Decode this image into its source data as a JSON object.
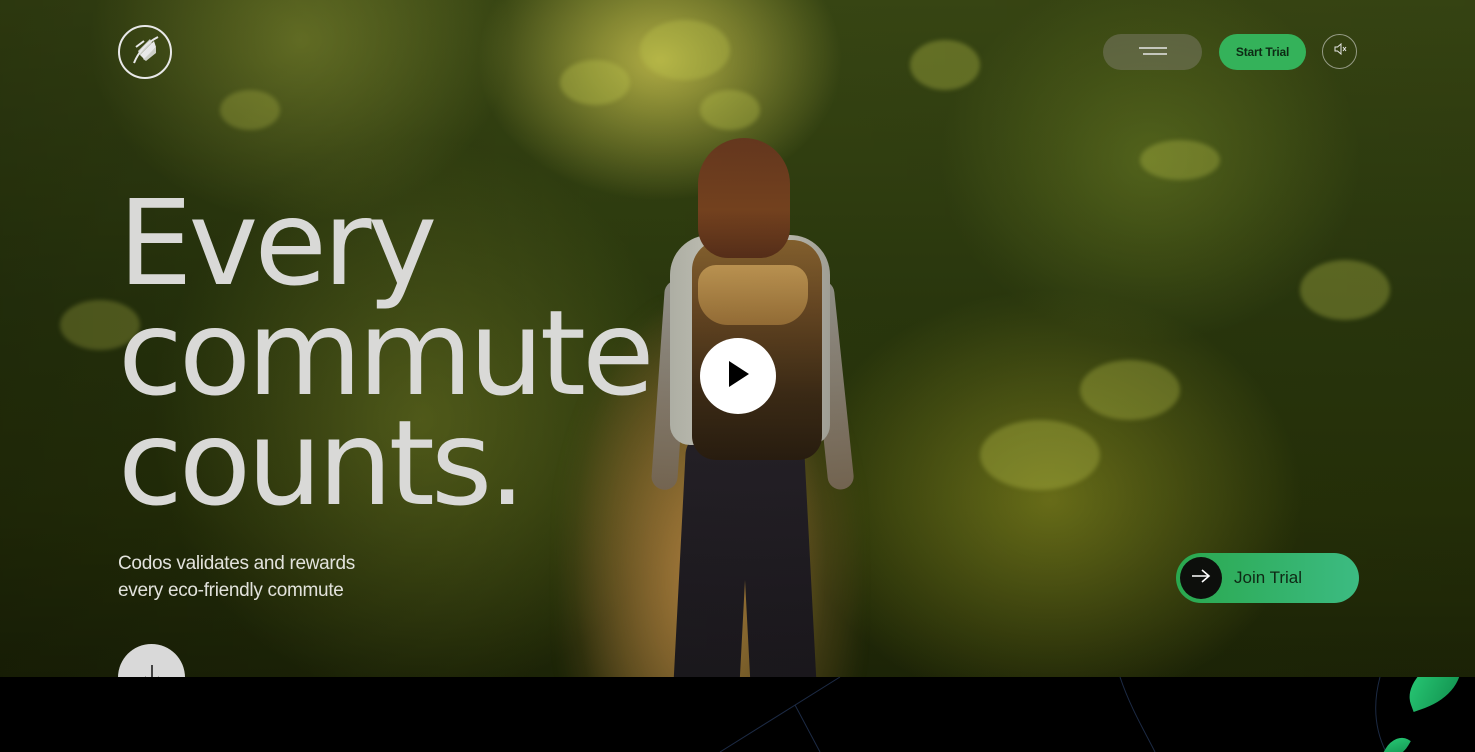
{
  "header": {
    "start_trial_label": "Start Trial"
  },
  "hero": {
    "headline_lines": [
      "Every",
      "commute",
      "counts."
    ],
    "subtitle_line1": "Codos validates and rewards",
    "subtitle_line2": "every eco-friendly commute",
    "join_label": "Join Trial"
  },
  "icons": {
    "logo": "leaf-logo-icon",
    "menu": "hamburger-icon",
    "sound": "speaker-muted-icon",
    "play": "play-icon",
    "join": "arrow-right-icon",
    "scroll": "arrow-down-icon"
  },
  "colors": {
    "accent_green": "#34b25a",
    "headline": "#d9d9d7",
    "background": "#000000"
  }
}
